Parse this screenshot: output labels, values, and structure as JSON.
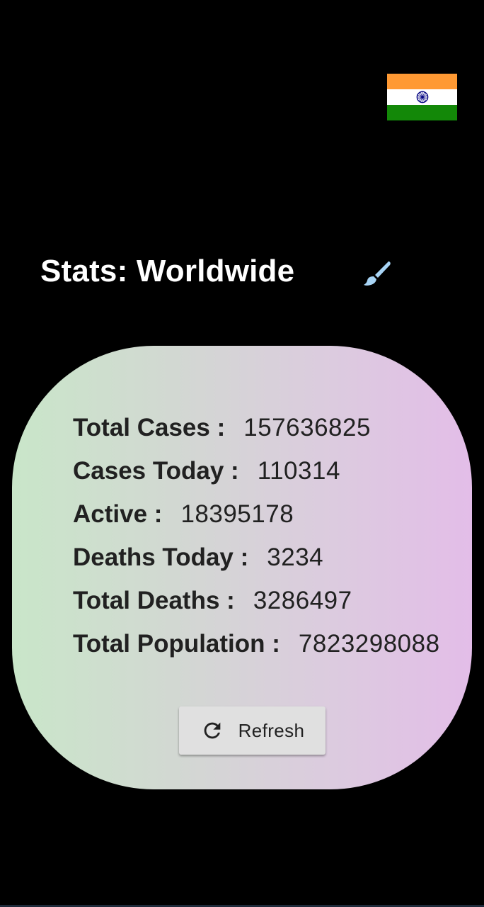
{
  "header": {
    "title": "Stats: Worldwide",
    "flag_icon": "india-flag-icon",
    "theme_icon": "paint-brush-icon",
    "theme_icon_color": "#a8d4f5"
  },
  "colors": {
    "background": "#000000",
    "card_gradient_start": "#c9e6c9",
    "card_gradient_end": "#e3bde8",
    "text_primary": "#212121",
    "button_bg": "#e0e0e0"
  },
  "stats": [
    {
      "label": "Total Cases :",
      "value": "157636825"
    },
    {
      "label": "Cases Today :",
      "value": "110314"
    },
    {
      "label": "Active :",
      "value": "18395178"
    },
    {
      "label": "Deaths Today :",
      "value": "3234"
    },
    {
      "label": "Total Deaths :",
      "value": "3286497"
    },
    {
      "label": "Total Population :",
      "value": "7823298088"
    }
  ],
  "refresh": {
    "label": "Refresh",
    "icon": "refresh-icon"
  }
}
